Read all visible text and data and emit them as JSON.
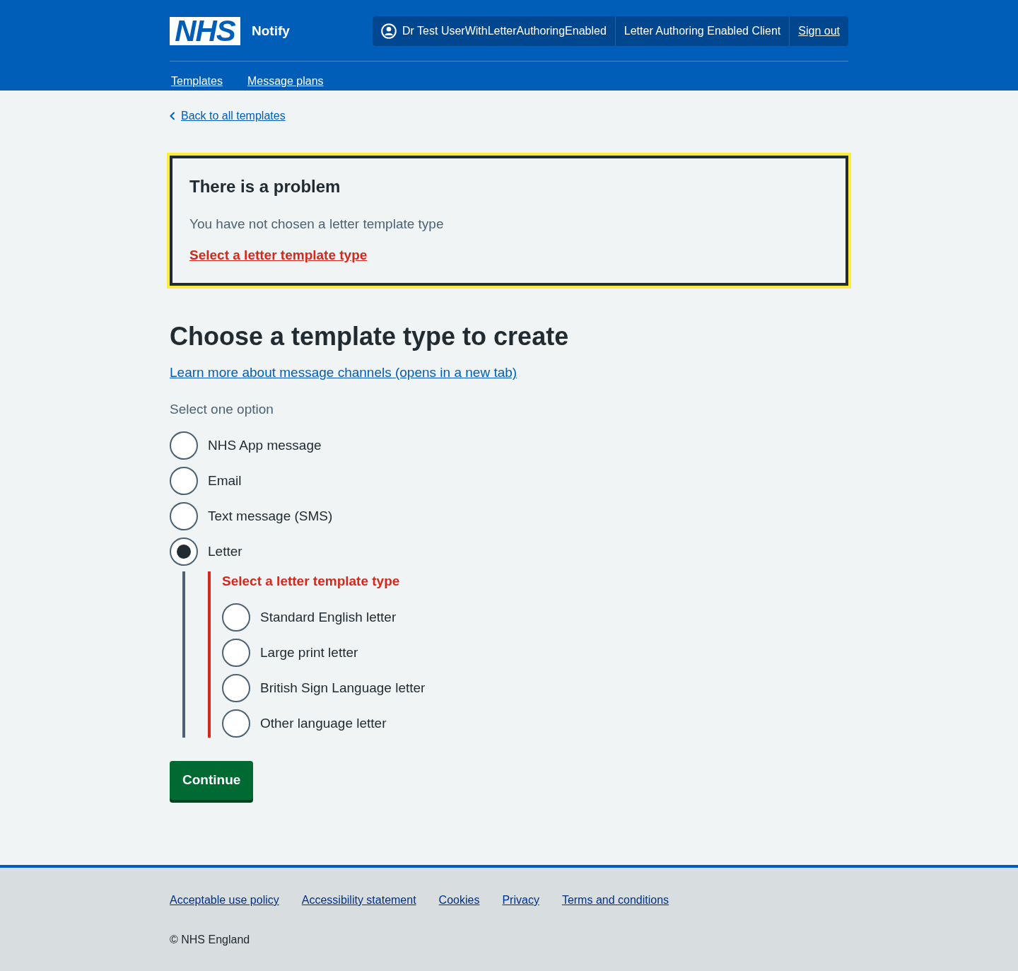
{
  "header": {
    "logo": "NHS",
    "service_name": "Notify",
    "account": {
      "user": "Dr Test UserWithLetterAuthoringEnabled",
      "client": "Letter Authoring Enabled Client",
      "sign_out": "Sign out"
    },
    "nav": [
      {
        "label": "Templates"
      },
      {
        "label": "Message plans"
      }
    ]
  },
  "back_link": "Back to all templates",
  "error_summary": {
    "title": "There is a problem",
    "description": "You have not chosen a letter template type",
    "errors": [
      "Select a letter template type"
    ]
  },
  "heading": "Choose a template type to create",
  "learn_more_link": "Learn more about message channels (opens in a new tab)",
  "form": {
    "hint": "Select one option",
    "options": [
      {
        "label": "NHS App message",
        "selected": false
      },
      {
        "label": "Email",
        "selected": false
      },
      {
        "label": "Text message (SMS)",
        "selected": false
      },
      {
        "label": "Letter",
        "selected": true,
        "conditional": {
          "error": "Select a letter template type",
          "options": [
            {
              "label": "Standard English letter",
              "selected": false
            },
            {
              "label": "Large print letter",
              "selected": false
            },
            {
              "label": "British Sign Language letter",
              "selected": false
            },
            {
              "label": "Other language letter",
              "selected": false
            }
          ]
        }
      }
    ]
  },
  "continue_button": "Continue",
  "footer": {
    "links": [
      "Acceptable use policy",
      "Accessibility statement",
      "Cookies",
      "Privacy",
      "Terms and conditions"
    ],
    "copyright": "© NHS England"
  }
}
